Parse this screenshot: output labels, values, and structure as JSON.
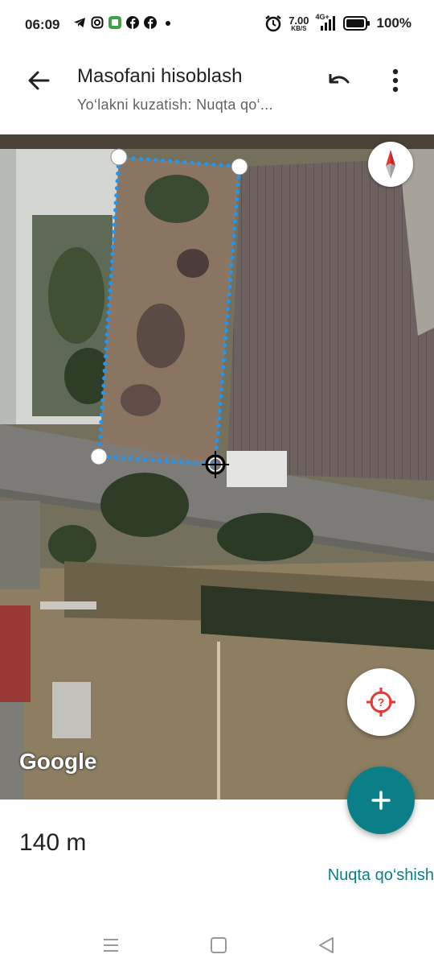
{
  "status_bar": {
    "time": "06:09",
    "speed_value": "7.00",
    "speed_unit": "KB/S",
    "network": "4G+",
    "battery": "100%",
    "icons": [
      "telegram-icon",
      "instagram-icon",
      "app-icon",
      "facebook-icon",
      "facebook-icon",
      "dot-icon",
      "alarm-icon",
      "signal-icon",
      "battery-icon"
    ]
  },
  "appbar": {
    "title": "Masofani hisoblash",
    "subtitle": "Yo‘lakni kuzatish: Nuqta qo‘...",
    "icons": [
      "back-arrow-icon",
      "undo-icon",
      "more-vert-icon"
    ]
  },
  "map": {
    "attribution": "Google",
    "colors": {
      "path": "#2196f3",
      "fab": "#0b7f88",
      "location_target": "#e53935",
      "compass_north": "#e53935"
    }
  },
  "bottom": {
    "distance": "140 m",
    "add_point_label": "Nuqta qo‘shish"
  },
  "navbar": {
    "icons": [
      "menu-icon",
      "home-square-icon",
      "back-triangle-icon"
    ]
  }
}
